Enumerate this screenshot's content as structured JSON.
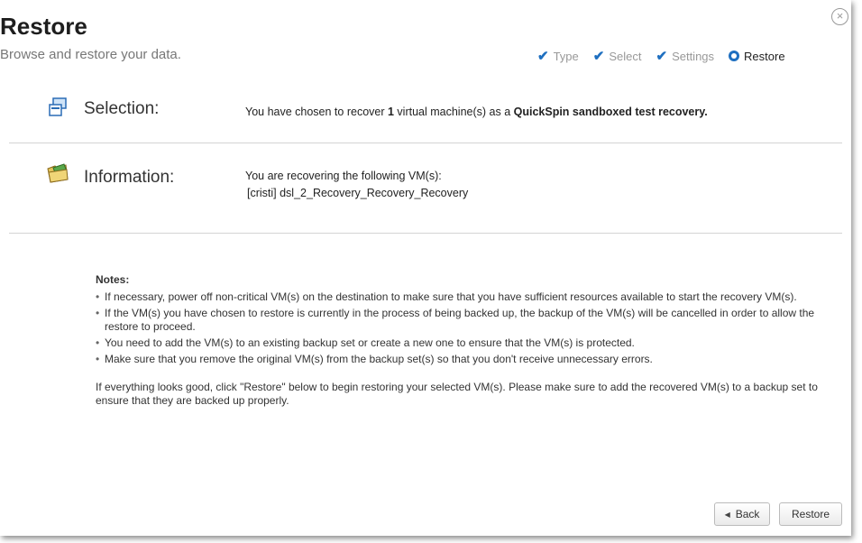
{
  "header": {
    "title": "Restore",
    "subtitle": "Browse and restore your data.",
    "close_glyph": "×"
  },
  "steps": [
    {
      "label": "Type",
      "state": "done"
    },
    {
      "label": "Select",
      "state": "done"
    },
    {
      "label": "Settings",
      "state": "done"
    },
    {
      "label": "Restore",
      "state": "current"
    }
  ],
  "selection": {
    "label": "Selection:",
    "text_prefix": "You have chosen to recover ",
    "count": "1",
    "text_mid": " virtual machine(s) as a ",
    "mode": "QuickSpin sandboxed test recovery."
  },
  "information": {
    "label": "Information:",
    "line1": "You are recovering the following VM(s):",
    "vm": "[cristi] dsl_2_Recovery_Recovery_Recovery"
  },
  "notes": {
    "heading": "Notes:",
    "items": [
      "If necessary, power off non-critical VM(s) on the destination to make sure that you have sufficient resources available to start the recovery VM(s).",
      "If the VM(s) you have chosen to restore is currently in the process of being backed up, the backup of the VM(s) will be cancelled in order to allow the restore to proceed.",
      "You need to add the VM(s) to an existing backup set or create a new one to ensure that the VM(s) is protected.",
      "Make sure that you remove the original VM(s) from the backup set(s) so that you don't receive unnecessary errors."
    ],
    "closing": "If everything looks good, click \"Restore\" below to begin restoring your selected VM(s). Please make sure to add the recovered VM(s) to a backup set to ensure that they are backed up properly."
  },
  "buttons": {
    "back": "Back",
    "restore": "Restore"
  },
  "colors": {
    "accent": "#1e6fc0",
    "separator": "#d4d4d4"
  }
}
